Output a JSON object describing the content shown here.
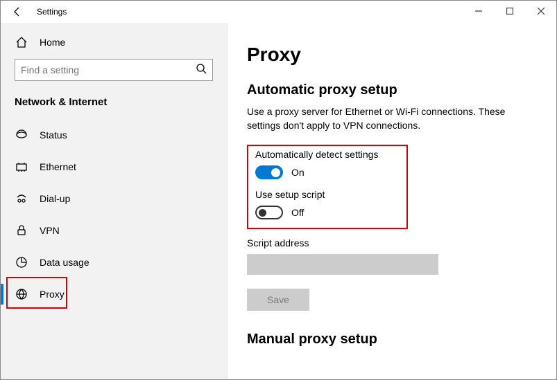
{
  "window": {
    "title": "Settings"
  },
  "sidebar": {
    "home_label": "Home",
    "search_placeholder": "Find a setting",
    "section_header": "Network & Internet",
    "items": [
      {
        "label": "Status"
      },
      {
        "label": "Ethernet"
      },
      {
        "label": "Dial-up"
      },
      {
        "label": "VPN"
      },
      {
        "label": "Data usage"
      },
      {
        "label": "Proxy"
      }
    ]
  },
  "content": {
    "page_title": "Proxy",
    "section1_title": "Automatic proxy setup",
    "section1_desc": "Use a proxy server for Ethernet or Wi-Fi connections. These settings don't apply to VPN connections.",
    "auto_detect": {
      "label": "Automatically detect settings",
      "state": "On"
    },
    "use_script": {
      "label": "Use setup script",
      "state": "Off"
    },
    "script_address_label": "Script address",
    "script_address_value": "",
    "save_label": "Save",
    "section2_title": "Manual proxy setup"
  }
}
